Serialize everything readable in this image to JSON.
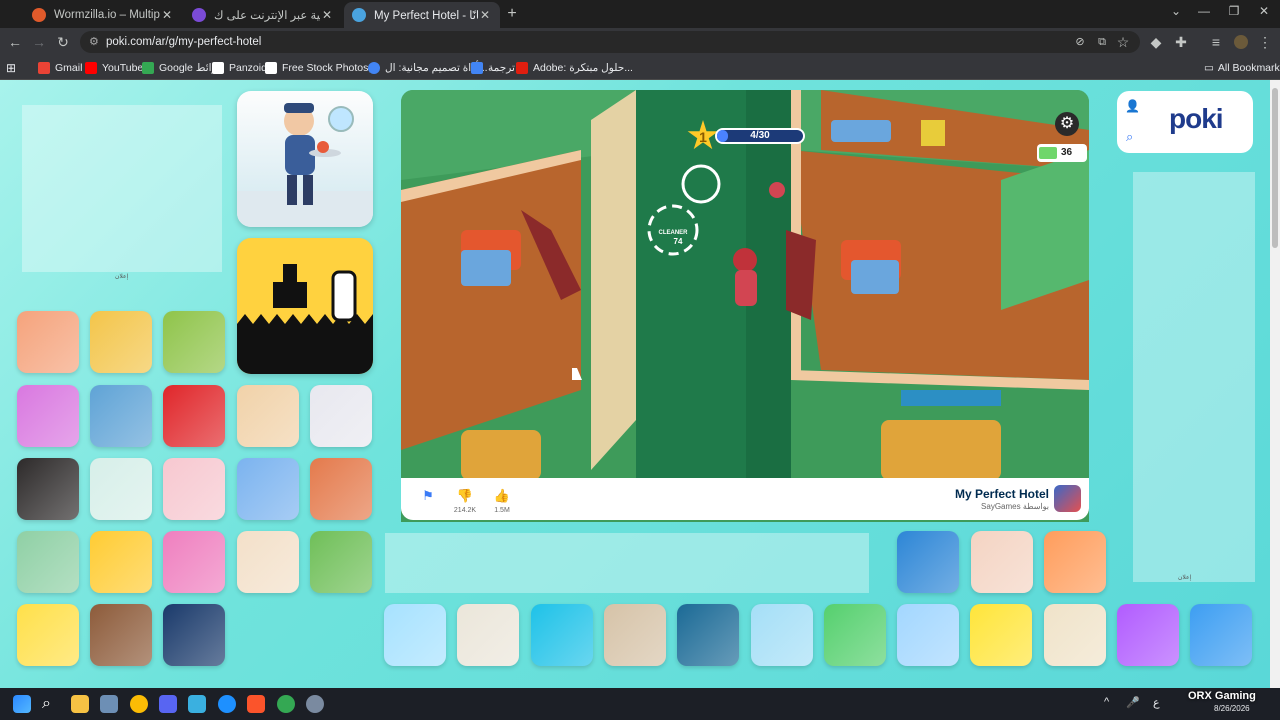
{
  "browser": {
    "tabs": [
      {
        "title": "Wormzilla.io – Multiplayer Snak",
        "color": "#e05a2b",
        "active": false
      },
      {
        "title": "ألعاب مجانية عبر الإنترنت على ك",
        "color": "#7b4bd6",
        "active": false
      },
      {
        "title": "My Perfect Hotel - الإنترنت مجانًا",
        "color": "#4aa3df",
        "active": true
      }
    ],
    "new_tab": "+",
    "url": "poki.com/ar/g/my-perfect-hotel",
    "bookmarks": [
      {
        "label": "Gmail",
        "color": "#ea4335"
      },
      {
        "label": "YouTube",
        "color": "#ff0000"
      },
      {
        "label": "Google خرائط",
        "color": "#34a853"
      },
      {
        "label": "Panzoid",
        "color": "#ffffff"
      },
      {
        "label": "Free Stock Photos,...",
        "color": "#ffffff"
      },
      {
        "label": "أداة تصميم مجانية: ال...",
        "color": "#4285f4"
      },
      {
        "label": "ترجمة",
        "color": "#4285f4"
      },
      {
        "label": "Adobe: حلول مبتكرة...",
        "color": "#e01e0f"
      }
    ],
    "all_bookmarks": "All Bookmarks"
  },
  "game": {
    "title": "My Perfect Hotel",
    "developer": "SayGames",
    "by_label": "بواسطة",
    "level": "1",
    "progress": "4/30",
    "progress_fraction": 0.133,
    "money": "36",
    "cleaner_label": "CLEANER",
    "cleaner_cost": "74",
    "dislikes": "214.2K",
    "likes": "1.5M"
  },
  "site": {
    "logo": "poki",
    "ad_label_left": "إعلان",
    "ad_label_right": "إعلان"
  },
  "thumbs": {
    "left_colors": [
      "#f5a37c",
      "#f3c54a",
      "#8fc44a",
      "#d978e0",
      "#5fa3d6",
      "#e0262a",
      "#f1d2a9",
      "#e8e8ef",
      "#2d2a2a",
      "#d7efe9",
      "#f7c8d0",
      "#7bb3ef",
      "#e47a4c",
      "#8fd0a5",
      "#ffcc33",
      "#ef7fbf",
      "#f3e0c9",
      "#6fbf58",
      "#ffe04a",
      "#8d5b3a",
      "#1a3a6b"
    ],
    "bottom_colors": [
      "#a7e2ff",
      "#ebe6da",
      "#1ec2e8",
      "#d6c3a8",
      "#1b6a96",
      "#a5dff7",
      "#55d06e",
      "#a3d7ff",
      "#ffe53a",
      "#f0e3c9",
      "#b15cff",
      "#3d9ef2"
    ],
    "right_colors": [
      "#2d86d6",
      "#f4d4c3",
      "#ff9d5c"
    ]
  },
  "taskbar": {
    "time_label": "8/26/2026",
    "lang": "ع",
    "watermark": "ORX Gaming"
  }
}
